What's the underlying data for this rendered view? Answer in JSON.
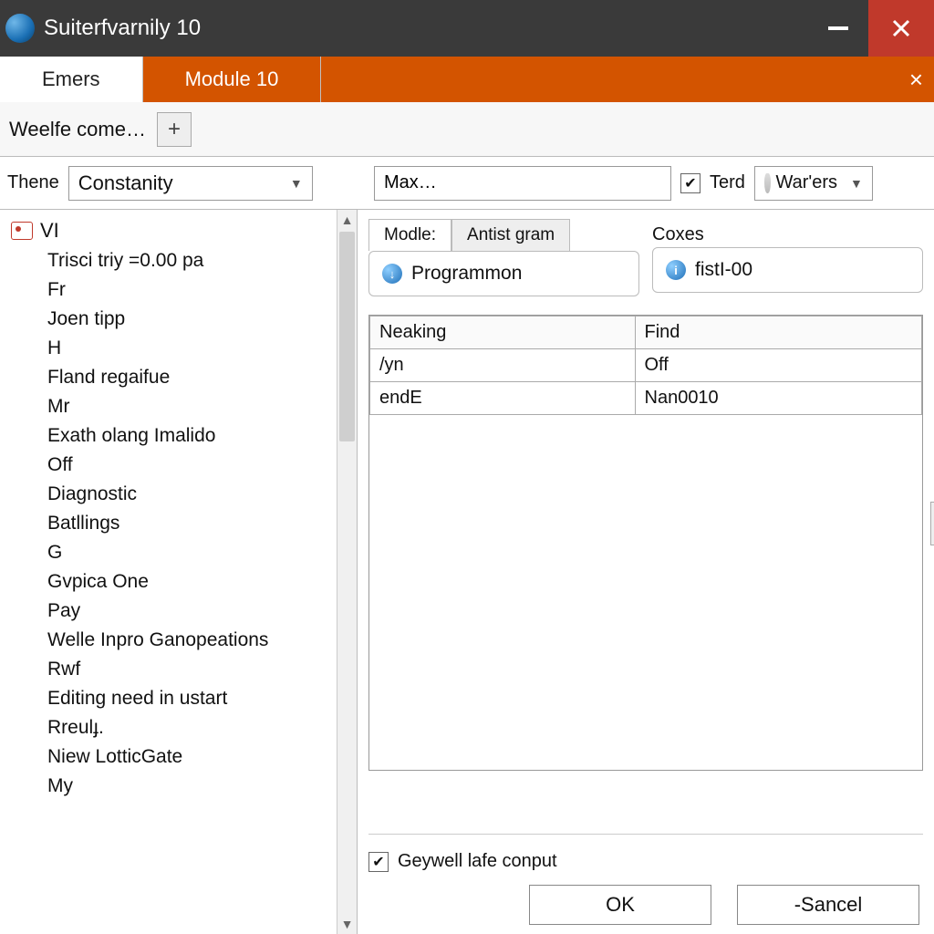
{
  "window": {
    "title": "Suiterfvarnily 10"
  },
  "tabs": {
    "active": "Emers",
    "inactive": "Module 10"
  },
  "subtab": {
    "label": "Weelfe come…"
  },
  "toolbar": {
    "theme_label": "Thene",
    "theme_value": "Constanity",
    "max_value": "Max…",
    "terd_checked": true,
    "terd_label": "Terd",
    "warers_value": "War'ers"
  },
  "tree": {
    "root": "VI",
    "items": [
      "Trisci triy =0.00 pa",
      "Fr",
      "Joen tipp",
      "H",
      "Fland regaifue",
      "Mr",
      "Exath olang Imalido",
      "Off",
      "Diagnostic",
      "Batllings",
      "G",
      "Gvpica One",
      "Pay",
      "Welle Inpro Ganopeations",
      "Rwf",
      "Editing need in ustart",
      "Rreulɟ.",
      "Niew LotticGate",
      "My"
    ]
  },
  "right": {
    "modle_tab_label": "Modle:",
    "artist_tab_label": "Antist gram",
    "modle_value": "Programmon",
    "coxes_label": "Coxes",
    "coxes_value": "fistI-00"
  },
  "grid": {
    "headers": [
      "Neaking",
      "Find"
    ],
    "rows": [
      [
        "/yn",
        "Off"
      ],
      [
        "endE",
        "Nan0010"
      ]
    ]
  },
  "footer": {
    "output_checked": true,
    "output_label": "Geywell lafe conput",
    "ok": "OK",
    "cancel": "-Sancel"
  }
}
